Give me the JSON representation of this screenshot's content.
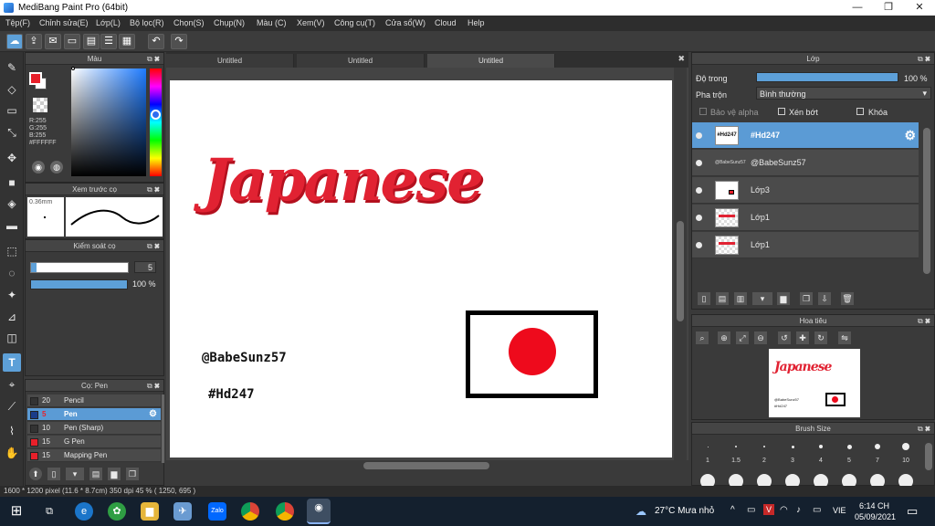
{
  "app": {
    "title": "MediBang Paint Pro (64bit)"
  },
  "window_controls": {
    "minimize": "—",
    "maximize": "❐",
    "close": "✕"
  },
  "menu": [
    "Tệp(F)",
    "Chỉnh sửa(E)",
    "Lớp(L)",
    "Bộ lọc(R)",
    "Chọn(S)",
    "Chụp(N)",
    "Màu (C)",
    "Xem(V)",
    "Công cụ(T)",
    "Cửa sổ(W)",
    "Cloud",
    "Help"
  ],
  "tabs": [
    "Untitled",
    "Untitled",
    "Untitled"
  ],
  "color_panel": {
    "title": "Màu",
    "r": "R:255",
    "g": "G:255",
    "b": "B:255",
    "hex": "#FFFFFF",
    "foreground": "#e8202a",
    "background": "#ffffff"
  },
  "brush_preview": {
    "title": "Xem trước cọ",
    "size": "0.36mm"
  },
  "brush_control": {
    "title": "Kiểm soát cọ",
    "size_value": "5",
    "opacity_value": "100 %",
    "opacity_percent": 100
  },
  "brush_list": {
    "title": "Cọ: Pen",
    "items": [
      {
        "size": "20",
        "name": "Pencil",
        "color": "#333333"
      },
      {
        "size": "5",
        "name": "Pen",
        "color": "#1a3c8a"
      },
      {
        "size": "10",
        "name": "Pen (Sharp)",
        "color": "#333333"
      },
      {
        "size": "15",
        "name": "G Pen",
        "color": "#e8202a"
      },
      {
        "size": "15",
        "name": "Mapping Pen",
        "color": "#e8202a"
      }
    ]
  },
  "canvas": {
    "title_text": "Japanese",
    "credit": "@BabeSunz57",
    "hashtag": "#Hd247"
  },
  "layer_panel": {
    "title": "Lớp",
    "opacity_label": "Độ trong",
    "opacity_value": "100 %",
    "blend_label": "Pha trộn",
    "blend_value": "Bình thường",
    "protect_alpha": "Bảo vệ alpha",
    "clipping": "Xén bớt",
    "lock": "Khóa",
    "layers": [
      {
        "name": "#Hd247",
        "selected": true
      },
      {
        "name": "@BabeSunz57",
        "selected": false
      },
      {
        "name": "Lớp3",
        "selected": false
      },
      {
        "name": "Lớp1",
        "selected": false
      },
      {
        "name": "Lớp1",
        "selected": false
      }
    ]
  },
  "navigator": {
    "title": "Hoa tiêu"
  },
  "brush_size": {
    "title": "Brush Size",
    "sizes": [
      "1",
      "1.5",
      "2",
      "3",
      "4",
      "5",
      "7",
      "10"
    ]
  },
  "status": {
    "info": "1600 * 1200 pixel   (11.6 * 8.7cm)   350 dpi   45 %   ( 1250, 695 )"
  },
  "taskbar": {
    "weather": "27°C  Mưa nhỏ",
    "lang": "VIE",
    "time": "6:14 CH",
    "date": "05/09/2021"
  }
}
